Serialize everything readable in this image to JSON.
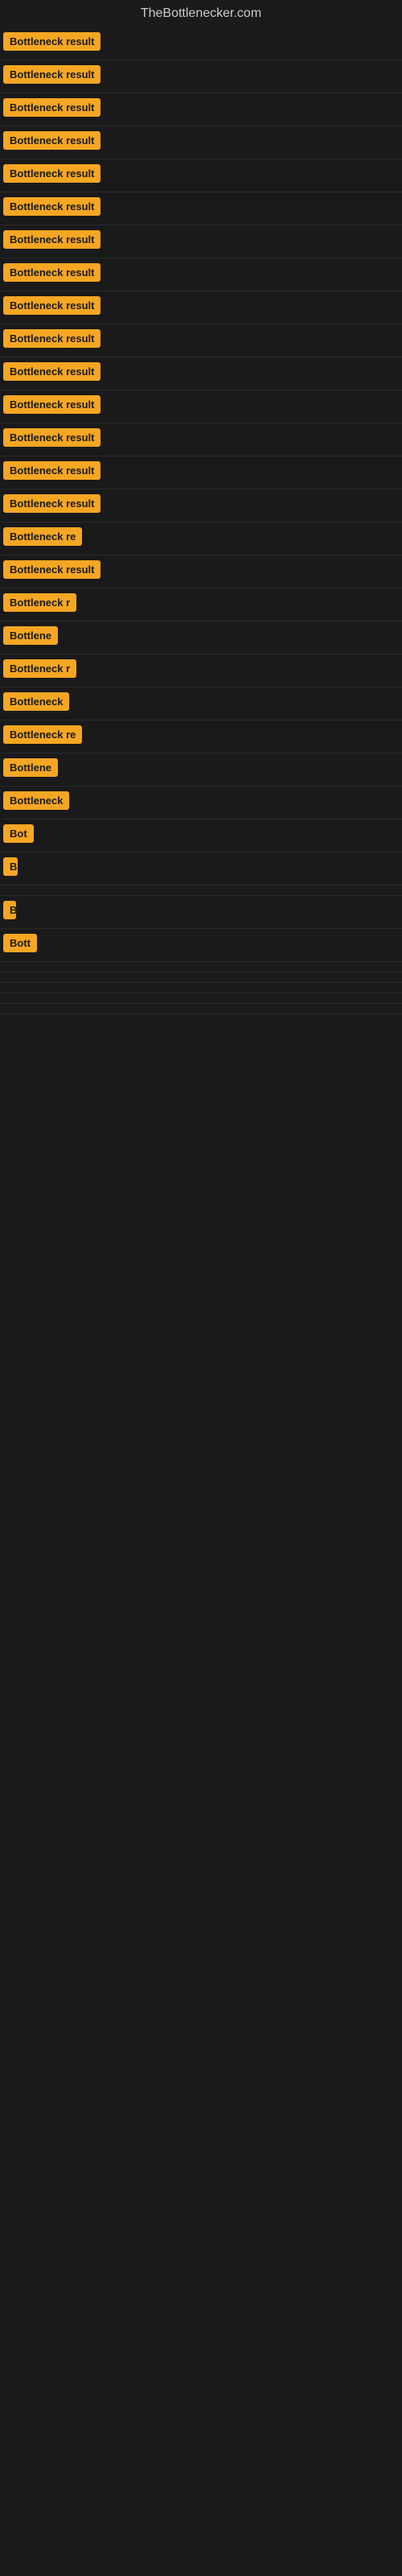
{
  "header": {
    "title": "TheBottlenecker.com"
  },
  "results": [
    {
      "label": "Bottleneck result",
      "width": 140
    },
    {
      "label": "Bottleneck result",
      "width": 140
    },
    {
      "label": "Bottleneck result",
      "width": 140
    },
    {
      "label": "Bottleneck result",
      "width": 140
    },
    {
      "label": "Bottleneck result",
      "width": 140
    },
    {
      "label": "Bottleneck result",
      "width": 140
    },
    {
      "label": "Bottleneck result",
      "width": 140
    },
    {
      "label": "Bottleneck result",
      "width": 140
    },
    {
      "label": "Bottleneck result",
      "width": 140
    },
    {
      "label": "Bottleneck result",
      "width": 140
    },
    {
      "label": "Bottleneck result",
      "width": 140
    },
    {
      "label": "Bottleneck result",
      "width": 140
    },
    {
      "label": "Bottleneck result",
      "width": 140
    },
    {
      "label": "Bottleneck result",
      "width": 140
    },
    {
      "label": "Bottleneck result",
      "width": 140
    },
    {
      "label": "Bottleneck re",
      "width": 110
    },
    {
      "label": "Bottleneck result",
      "width": 130
    },
    {
      "label": "Bottleneck r",
      "width": 105
    },
    {
      "label": "Bottlene",
      "width": 80
    },
    {
      "label": "Bottleneck r",
      "width": 100
    },
    {
      "label": "Bottleneck",
      "width": 95
    },
    {
      "label": "Bottleneck re",
      "width": 108
    },
    {
      "label": "Bottlene",
      "width": 78
    },
    {
      "label": "Bottleneck",
      "width": 90
    },
    {
      "label": "Bot",
      "width": 40
    },
    {
      "label": "B",
      "width": 18
    },
    {
      "label": "",
      "width": 0
    },
    {
      "label": "B",
      "width": 16
    },
    {
      "label": "Bott",
      "width": 45
    },
    {
      "label": "",
      "width": 0
    },
    {
      "label": "",
      "width": 0
    },
    {
      "label": "",
      "width": 0
    },
    {
      "label": "",
      "width": 0
    },
    {
      "label": "",
      "width": 0
    }
  ]
}
